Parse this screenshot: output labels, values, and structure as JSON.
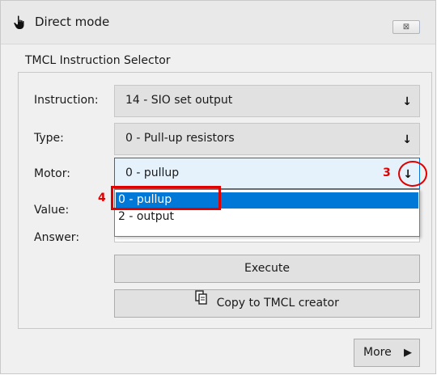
{
  "window": {
    "title": "Direct mode",
    "title_icon": "hand-pointer-icon",
    "close_icon": "close-icon",
    "close_label": "⊠"
  },
  "group": {
    "title": "TMCL Instruction Selector"
  },
  "fields": {
    "instruction_label": "Instruction:",
    "instruction_value": "14 - SIO set output",
    "type_label": "Type:",
    "type_value": "0 - Pull-up resistors",
    "motor_label": "Motor:",
    "motor_value": "0 - pullup",
    "value_label": "Value:",
    "answer_label": "Answer:",
    "dropdown_arrow": "↓"
  },
  "dropdown": {
    "options": [
      "0 - pullup",
      "2 - output"
    ],
    "selected_index": 0
  },
  "buttons": {
    "execute": "Execute",
    "copy": "Copy to TMCL creator",
    "copy_icon": "copy-document-icon",
    "more": "More",
    "more_icon": "▶"
  },
  "annotations": {
    "step3": "3",
    "step4": "4",
    "color": "#e00000"
  },
  "colors": {
    "accent": "#0078d7",
    "window_bg": "#f0f0f0",
    "control_bg": "#e1e1e1"
  }
}
